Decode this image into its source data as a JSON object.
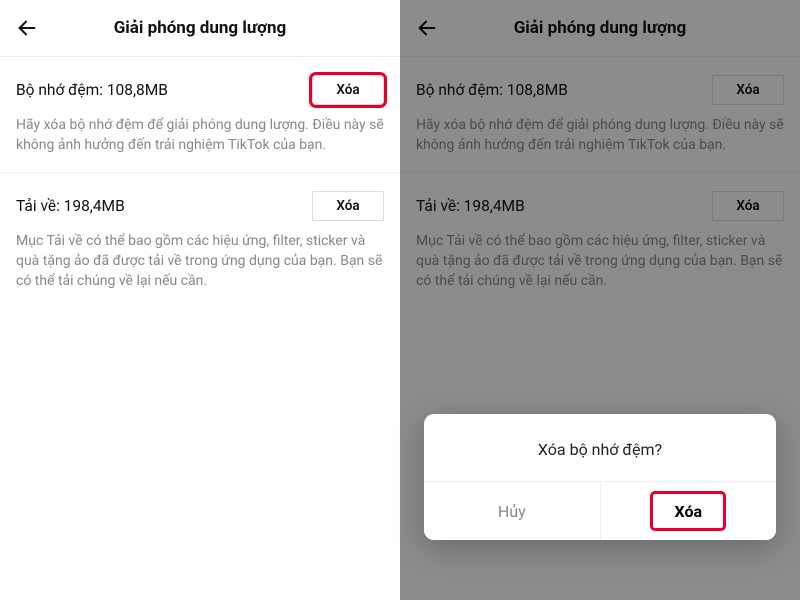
{
  "header": {
    "title": "Giải phóng dung lượng"
  },
  "cache": {
    "label": "Bộ nhớ đệm: 108,8MB",
    "clear_label": "Xóa",
    "description": "Hãy xóa bộ nhớ đệm để giải phóng dung lượng. Điều này sẽ không ảnh hưởng đến trải nghiệm TikTok của bạn."
  },
  "downloads": {
    "label": "Tải về: 198,4MB",
    "clear_label": "Xóa",
    "description": "Mục Tải về có thể bao gồm các hiệu ứng, filter, sticker và quà tặng ảo đã được tải về trong ứng dụng của bạn. Bạn sẽ có thể tải chúng về lại nếu cần."
  },
  "dialog": {
    "title": "Xóa bộ nhớ đệm?",
    "cancel": "Hủy",
    "confirm": "Xóa"
  }
}
